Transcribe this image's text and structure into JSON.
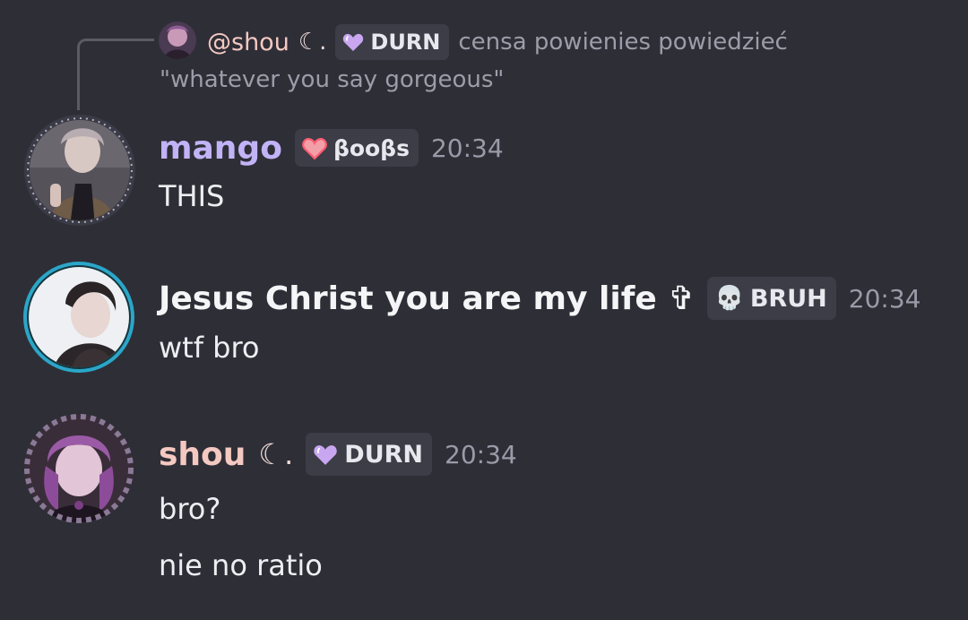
{
  "reply": {
    "author": "@shou",
    "author_decoration": "☾.",
    "role_tag": "DURN",
    "preview_line1": "censa powienies powiedzieć",
    "preview_line2": "\"whatever you say gorgeous\""
  },
  "messages": [
    {
      "author": "mango",
      "author_color": "#c2b3f7",
      "role_tag": "βooβs",
      "role_icon": "red-heart-icon",
      "time": "20:34",
      "lines": [
        "THIS"
      ]
    },
    {
      "author": "Jesus Christ you are my life ✞",
      "author_color": "#f5f5f7",
      "role_tag": "BRUH",
      "role_icon": "skull-icon",
      "time": "20:34",
      "lines": [
        "wtf bro"
      ]
    },
    {
      "author": "shou",
      "author_decoration": "☾.",
      "author_color": "#f4c9c1",
      "role_tag": "DURN",
      "role_icon": "purple-heart-icon",
      "time": "20:34",
      "lines": [
        "bro?",
        "nie no ratio"
      ]
    }
  ],
  "colors": {
    "background": "#2e2e37",
    "tag_background": "#3c3d47",
    "timestamp": "#9a9aa8"
  }
}
